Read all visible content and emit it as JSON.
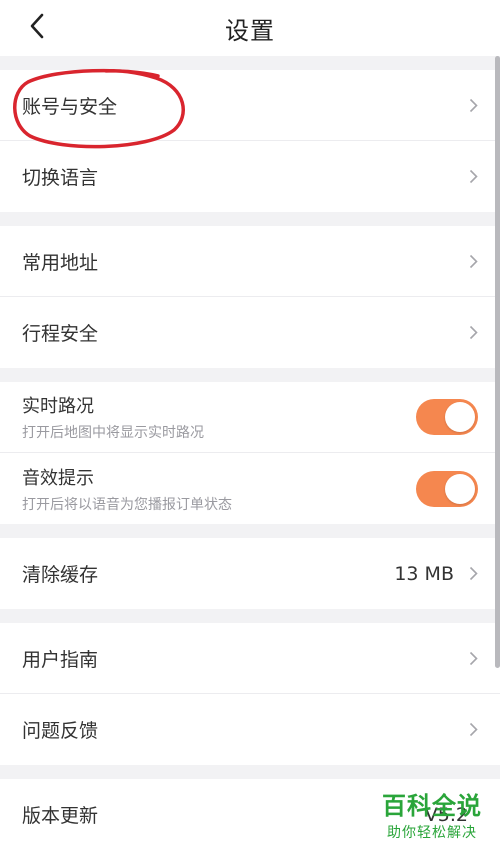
{
  "header": {
    "title": "设置"
  },
  "groups": [
    {
      "items": [
        {
          "label": "账号与安全"
        },
        {
          "label": "切换语言"
        }
      ]
    },
    {
      "items": [
        {
          "label": "常用地址"
        },
        {
          "label": "行程安全"
        }
      ]
    },
    {
      "items": [
        {
          "label": "实时路况",
          "subtitle": "打开后地图中将显示实时路况",
          "enabled": true
        },
        {
          "label": "音效提示",
          "subtitle": "打开后将以语音为您播报订单状态",
          "enabled": true
        }
      ]
    },
    {
      "items": [
        {
          "label": "清除缓存",
          "value": "13 MB"
        }
      ]
    },
    {
      "items": [
        {
          "label": "用户指南"
        },
        {
          "label": "问题反馈"
        }
      ]
    },
    {
      "items": [
        {
          "label": "版本更新",
          "value": "V5.2"
        }
      ]
    }
  ],
  "watermark": {
    "brand": "百科全说",
    "slogan": "助你轻松解决"
  },
  "colors": {
    "accent_toggle": "#f5874f",
    "annotation_red": "#d9252e",
    "watermark_green": "#2aa53a",
    "page_bg": "#f2f2f4"
  },
  "icons": {
    "back": "chevron-left-icon",
    "row_arrow": "chevron-right-icon"
  }
}
